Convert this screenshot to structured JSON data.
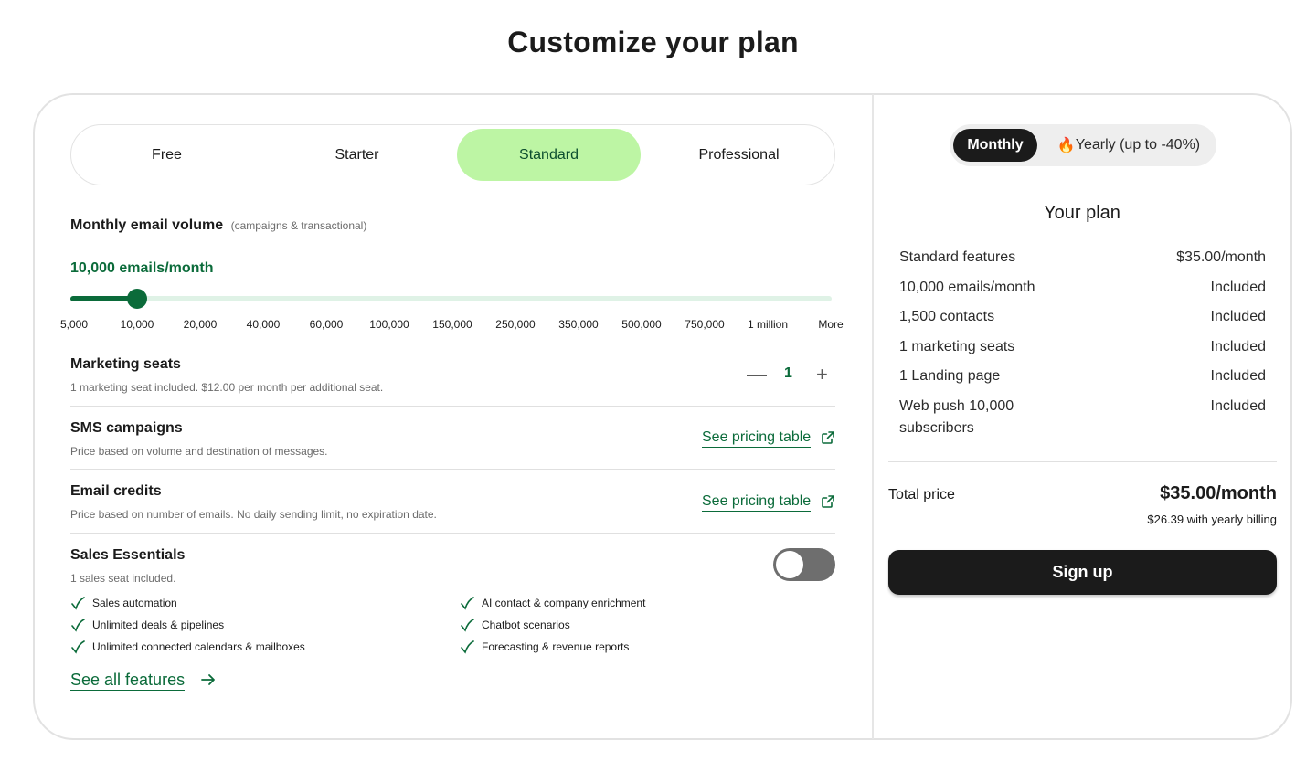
{
  "title": "Customize your plan",
  "plans": [
    {
      "label": "Free",
      "active": false
    },
    {
      "label": "Starter",
      "active": false
    },
    {
      "label": "Standard",
      "active": true
    },
    {
      "label": "Professional",
      "active": false
    }
  ],
  "email_volume": {
    "label": "Monthly email volume",
    "hint": "(campaigns & transactional)",
    "value_text": "10,000 emails/month",
    "ticks": [
      "5,000",
      "10,000",
      "20,000",
      "40,000",
      "60,000",
      "100,000",
      "150,000",
      "250,000",
      "350,000",
      "500,000",
      "750,000",
      "1 million",
      "More"
    ],
    "selected_index": 1
  },
  "marketing_seats": {
    "title": "Marketing seats",
    "subtitle": "1 marketing seat included. $12.00 per month per additional seat.",
    "value": "1",
    "minus": "—",
    "plus": "+"
  },
  "sms": {
    "title": "SMS campaigns",
    "subtitle": "Price based on volume and destination of messages.",
    "link": "See pricing table"
  },
  "email_credits": {
    "title": "Email credits",
    "subtitle": "Price based on number of emails. No daily sending limit, no expiration date.",
    "link": "See pricing table"
  },
  "sales": {
    "title": "Sales Essentials",
    "subtitle": "1 sales seat included.",
    "toggle_on": false,
    "features_left": [
      "Sales automation",
      "Unlimited deals & pipelines",
      "Unlimited connected calendars & mailboxes"
    ],
    "features_right": [
      "AI contact & company enrichment",
      "Chatbot scenarios",
      "Forecasting & revenue reports"
    ],
    "see_all": "See all features"
  },
  "billing": {
    "monthly": "Monthly",
    "yearly": "Yearly (up to -40%)",
    "yearly_emoji": "🔥",
    "active": "monthly"
  },
  "your_plan": {
    "title": "Your plan",
    "rows": [
      {
        "label": "Standard features",
        "value": "$35.00/month"
      },
      {
        "label": "10,000 emails/month",
        "value": "Included"
      },
      {
        "label": "1,500 contacts",
        "value": "Included"
      },
      {
        "label": "1 marketing seats",
        "value": "Included"
      },
      {
        "label": "1 Landing page",
        "value": "Included"
      },
      {
        "label": "Web push 10,000 subscribers",
        "value": "Included"
      }
    ]
  },
  "total": {
    "label": "Total price",
    "price": "$35.00/month",
    "yearly_note": "$26.39 with yearly billing"
  },
  "signup": "Sign up",
  "colors": {
    "brand_green": "#0b6b3a",
    "active_tab": "#bdf5a4",
    "dark": "#1b1b1b"
  }
}
